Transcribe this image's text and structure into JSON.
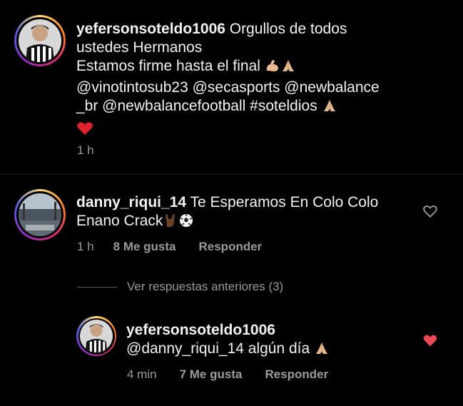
{
  "main_comment": {
    "username": "yefersonsoteldo1006",
    "line1_rest": " Orgullos de todos",
    "line2": "ustedes Hermanos",
    "line3": "Estamos firme hasta el final",
    "line4": "@vinotintosub23 @secasports @newbalance",
    "line5": "_br @newbalancefootball #soteldios",
    "time": "1 h",
    "emojis": [
      "muscle-emoji",
      "pray-emoji",
      "pray-emoji",
      "red-heart-emoji"
    ]
  },
  "reply_comment": {
    "username": "danny_riqui_14",
    "line1_rest": " Te Esperamos En Colo Colo",
    "line2": "Enano Crack",
    "time": "1 h",
    "likes": "8 Me gusta",
    "reply_label": "Responder",
    "emojis": [
      "rock-hand-emoji",
      "soccer-ball-emoji"
    ],
    "like_state": "not-liked"
  },
  "view_previous": {
    "label": "Ver respuestas anteriores (3)"
  },
  "nested_reply": {
    "username": "yefersonsoteldo1006",
    "text": "@danny_riqui_14  algún día",
    "time": "4 min",
    "likes": "7 Me gusta",
    "reply_label": "Responder",
    "emojis": [
      "pray-emoji"
    ],
    "like_state": "liked"
  },
  "colors": {
    "background": "#000000",
    "text": "#f2f2f2",
    "meta": "#9a9a9a",
    "liked_heart": "#ed4956"
  }
}
